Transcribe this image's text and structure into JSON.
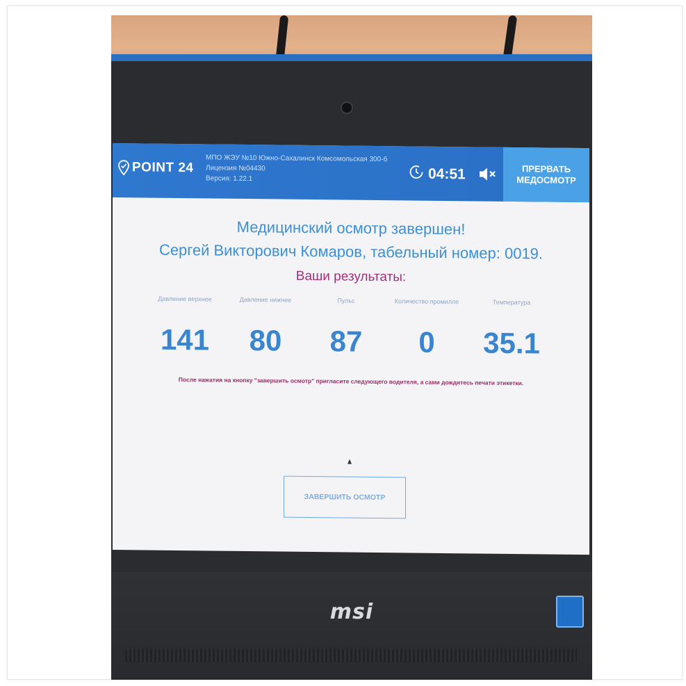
{
  "header": {
    "logo_text": "POINT 24",
    "org_line1": "МПО ЖЭУ №10 Южно-Сахалинск Комсомольская 300-б",
    "org_line2": "Лицензия №04430",
    "org_line3": "Версия: 1.22.1",
    "timer": "04:51",
    "abort_button": "ПРЕРВАТЬ МЕДОСМОТР"
  },
  "main": {
    "title": "Медицинский осмотр завершен!",
    "subtitle": "Сергей Викторович Комаров, табельный номер: 0019.",
    "results_label": "Ваши результаты:",
    "metrics": [
      {
        "label": "Давление верхнее",
        "value": "141"
      },
      {
        "label": "Давление нижнее",
        "value": "80"
      },
      {
        "label": "Пульс",
        "value": "87"
      },
      {
        "label": "Количество промилле",
        "value": "0"
      },
      {
        "label": "Температура",
        "value": "35.1"
      }
    ],
    "note": "После нажатия на кнопку \"завершить осмотр\" пригласите следующего водителя, а сами дождитесь печати этикетки.",
    "finish_button": "ЗАВЕРШИТЬ ОСМОТР"
  },
  "device": {
    "brand": "msi"
  },
  "colors": {
    "header_blue": "#2f78cf",
    "abort_blue": "#4aa1e6",
    "value_blue": "#3a85d0",
    "results_magenta": "#a0307a"
  },
  "icons": {
    "logo": "location-pin-icon",
    "timer": "timer-icon",
    "sound": "mute-icon"
  }
}
